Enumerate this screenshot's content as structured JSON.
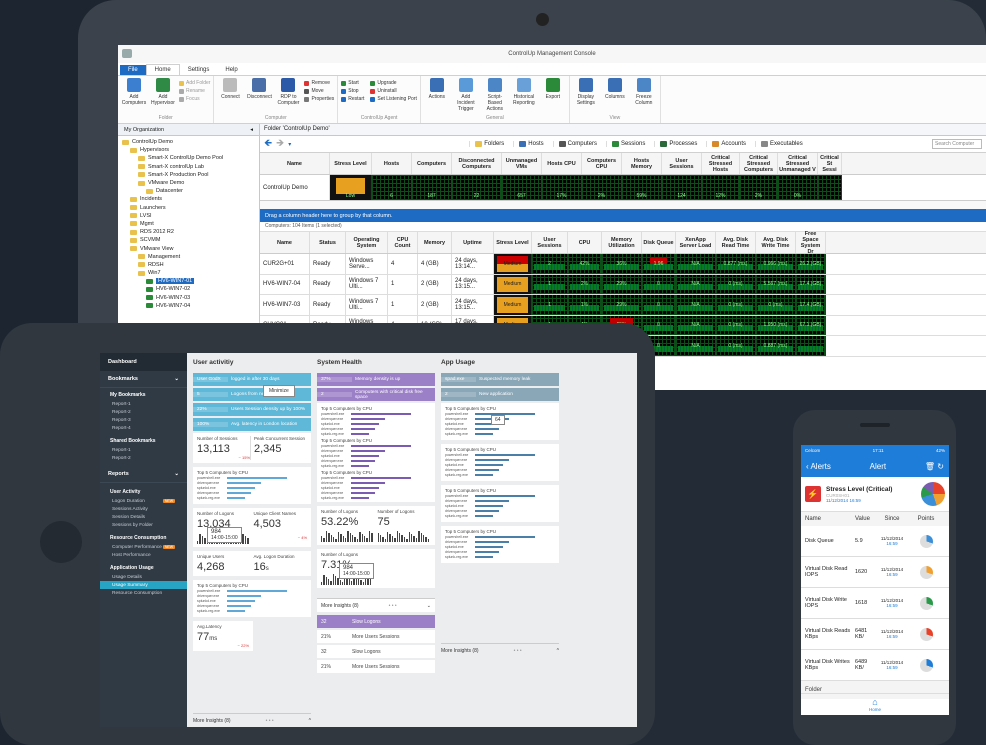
{
  "desktop": {
    "window_title": "ControlUp Management Console",
    "tabs": [
      "File",
      "Home",
      "Settings",
      "Help"
    ],
    "ribbon": {
      "folder_group": {
        "name": "Folder",
        "buttons": [
          "Add Computers",
          "Add Hypervisor"
        ],
        "small": [
          "Add Folder",
          "Rename",
          "Focus"
        ]
      },
      "computer_group": {
        "name": "Computer",
        "buttons": [
          "Connect",
          "Disconnect",
          "RDP to Computer",
          "Properties"
        ],
        "small": [
          "Remove",
          "Move",
          "Properties"
        ]
      },
      "agent_group": {
        "name": "ControlUp Agent",
        "small": [
          "Start",
          "Stop",
          "Restart",
          "Upgrade",
          "Uninstall",
          "Set Listening Port"
        ]
      },
      "general_group": {
        "name": "General",
        "buttons": [
          "Actions",
          "Add Incident Trigger",
          "Script-Based Actions",
          "Historical Reporting",
          "Export"
        ]
      },
      "view_group": {
        "name": "View",
        "buttons": [
          "Display Settings",
          "Columns",
          "Freeze Column"
        ]
      }
    },
    "org": {
      "header": "My Organization",
      "tree": [
        "ControlUp Demo",
        "Hypervisors",
        "Smart-X ControlUp Demo Pool",
        "Smart-X controlUp Lab",
        "Smart-X Production Pool",
        "VMware Demo",
        "Datacenter",
        "Incidents",
        "Launchers",
        "LVSI",
        "Mgmt",
        "RDS 2012 R2",
        "SCVMM",
        "VMware View",
        "Management",
        "RDSH",
        "Win7",
        "HV6-WIN7-01",
        "HV6-WIN7-02",
        "HV6-WIN7-03",
        "HV6-WIN7-04"
      ]
    },
    "folder_header": "Folder 'ControlUp Demo'",
    "views": [
      "Folders",
      "Hosts",
      "Computers",
      "Sessions",
      "Processes",
      "Accounts",
      "Executables"
    ],
    "search_placeholder": "Search Computer",
    "hosts_columns": [
      "Name",
      "Stress Level",
      "Hosts",
      "Computers",
      "Disconnected Computers",
      "Unmanaged VMs",
      "Hosts CPU",
      "Computers CPU",
      "Hosts Memory",
      "User Sessions",
      "Critical Stressed Hosts",
      "Critical Stressed Computers",
      "Critical Stressed Unmanaged V",
      "Critical St Sessi"
    ],
    "hosts_row": {
      "name": "ControlUp Demo",
      "values": [
        "Low",
        "6",
        "187",
        "22",
        "657",
        "17%",
        "2%",
        "59%",
        "124",
        "12%",
        "2%",
        "0%",
        ""
      ]
    },
    "drag_hint": "Drag a column header here to group by that column.",
    "count_text": "Computers: 104 Items (1 selected)",
    "comp_columns": [
      "Name",
      "Status",
      "Operating System",
      "CPU Count",
      "Memory",
      "Uptime",
      "Stress Level",
      "User Sessions",
      "CPU",
      "Memory Utilization",
      "Disk Queue",
      "XenApp Server Load",
      "Avg. Disk Read Time",
      "Avg. Disk Write Time",
      "Free Space System Dr"
    ],
    "computers": [
      {
        "name": "CUR2G+01",
        "status": "Ready",
        "os": "Windows Serve...",
        "cpu": "4",
        "mem": "4 (GB)",
        "up": "24 days, 13:14...",
        "stress": "Medium",
        "sess": "2",
        "cpuv": "42%",
        "memv": "36%",
        "dq": "1.96",
        "xen": "N/A",
        "dr": "0.877 (ms)",
        "dw": "0.966 (ms)",
        "fs": "26.2 (GB)"
      },
      {
        "name": "HV6-WIN7-04",
        "status": "Ready",
        "os": "Windows 7 Ulti...",
        "cpu": "1",
        "mem": "2 (GB)",
        "up": "24 days, 13:15...",
        "stress": "Medium",
        "sess": "1",
        "cpuv": "2%",
        "memv": "29%",
        "dq": "0",
        "xen": "N/A",
        "dr": "0 (ms)",
        "dw": "5.567 (ms)",
        "fs": "17.4 (GB)"
      },
      {
        "name": "HV6-WIN7-03",
        "status": "Ready",
        "os": "Windows 7 Ulti...",
        "cpu": "1",
        "mem": "2 (GB)",
        "up": "24 days, 13:15...",
        "stress": "Medium",
        "sess": "1",
        "cpuv": "1%",
        "memv": "29%",
        "dq": "0",
        "xen": "N/A",
        "dr": "0 (ms)",
        "dw": "0 (ms)",
        "fs": "17.4 (GB)"
      },
      {
        "name": "CUVC01",
        "status": "Ready",
        "os": "Windows Serve...",
        "cpu": "4",
        "mem": "10 (GB)",
        "up": "17 days, 21:49...",
        "stress": "Medium",
        "sess": "1",
        "cpuv": "4%",
        "memv": "65%",
        "dq": "0",
        "xen": "N/A",
        "dr": "0 (ms)",
        "dw": "1.950 (ms)",
        "fs": "67.1 (GB)"
      },
      {
        "name": "CUSQ0",
        "status": "Ready",
        "os": "Windows Serve...",
        "cpu": "2",
        "mem": "4 (GB)",
        "up": "24 days",
        "stress": "",
        "sess": "1",
        "cpuv": "3%",
        "memv": "",
        "dq": "0",
        "xen": "N/A",
        "dr": "0 (ms)",
        "dw": "0.887 (ms)",
        "fs": ""
      }
    ]
  },
  "tablet": {
    "sidebar": {
      "title": "Dashboard",
      "sections": [
        "Bookmarks",
        "Reports"
      ],
      "my_bookmarks": {
        "title": "My Bookmarks",
        "items": [
          "Report-1",
          "Report-2",
          "Report-3",
          "Report-4"
        ]
      },
      "shared_bookmarks": {
        "title": "Shared Bookmarks",
        "items": [
          "Report-1",
          "Report-2"
        ]
      },
      "user_activity": {
        "title": "User Activity",
        "items": [
          "Logon Duration",
          "Sessions Activity",
          "Session Details",
          "Sessions by Folder"
        ]
      },
      "resource": {
        "title": "Resource Consumption",
        "items": [
          "Computer Performance",
          "Host Performance"
        ]
      },
      "app_usage": {
        "title": "Application Usage",
        "items": [
          "Usage Details",
          "Usage Summary",
          "Resource Consumption"
        ]
      }
    },
    "user_activity": {
      "title": "User activitiy",
      "alerts": [
        {
          "value": "User GodX",
          "text": "logged in after 30 days"
        },
        {
          "value": "5",
          "text": "Logons from new computers"
        },
        {
          "value": "22%",
          "text": "Users Session density up by 100%"
        },
        {
          "value": "100%",
          "text": "Avg. latency in London location"
        }
      ],
      "minimize": "Minimize",
      "sessions": {
        "label": "Number of Sessions",
        "value": "13,113",
        "change": "~ 15%"
      },
      "peak": {
        "label": "Peak Concurrent Session",
        "value": "2,345"
      },
      "top5_title": "Top 5 Computers by CPU",
      "processes": [
        "powershell.exe",
        "driverquer.exe",
        "splunkd.exe",
        "driverquer.exe",
        "splunk-reg.exe"
      ],
      "logons": {
        "label": "Number of Logons",
        "value": "13,034",
        "tooltip_value": "984",
        "tooltip_time": "14:00-15:00"
      },
      "client_names": {
        "label": "Unique Client Names",
        "value": "4,503",
        "change": "~ 4%"
      },
      "unique_users": {
        "label": "Unique Users",
        "value": "4,268"
      },
      "logon_duration": {
        "label": "Avg. Logon Duration",
        "value": "16",
        "unit": "s"
      },
      "latency": {
        "label": "Avg.Latency",
        "value": "77",
        "unit": "ms",
        "change": "~ 22%"
      },
      "more": "More Insights (8)"
    },
    "system_health": {
      "title": "System Health",
      "alerts": [
        {
          "value": "37%",
          "text": "Memory density is up"
        },
        {
          "value": "2",
          "text": "Computers with critical disk free space"
        }
      ],
      "logons": {
        "label": "Number of Logons",
        "value": "53.22%",
        "change": "~ 3.1%"
      },
      "logons2": {
        "label": "Number of Logons",
        "value": "75"
      },
      "logons3": {
        "label": "Number of Logons",
        "value": "7.31%",
        "tooltip_value": "984",
        "tooltip_time": "14:00-15:00"
      },
      "more": "More Insights (8)",
      "insights": [
        {
          "value": "32",
          "text": "Slow Logons"
        },
        {
          "value": "21%",
          "text": "More Users Sessions"
        },
        {
          "value": "32",
          "text": "Slow Logons"
        },
        {
          "value": "21%",
          "text": "More Users Sessions"
        }
      ]
    },
    "app_usage": {
      "title": "App Usage",
      "alerts": [
        {
          "value": "spad.exe",
          "text": "Suspected memory leak"
        },
        {
          "value": "2",
          "text": "New application"
        }
      ],
      "tooltip_value": "64",
      "more": "More Insights (8)"
    }
  },
  "phone": {
    "carrier": "Celcom",
    "time": "17:11",
    "battery": "42%",
    "back_label": "Alerts",
    "title": "Alert",
    "alert_title": "Stress Level (Critical)",
    "alert_host": "CUR0SH01",
    "alert_date": "11/12/2014 16:59",
    "columns": [
      "Name",
      "Value",
      "Since",
      "Points"
    ],
    "rows": [
      {
        "name": "Disk Queue",
        "value": "5.9",
        "date": "11/12/2014",
        "time": "16:59"
      },
      {
        "name": "Virtual Disk Read IOPS",
        "value": "1620",
        "date": "11/12/2014",
        "time": "16:59"
      },
      {
        "name": "Virtual Disk Write IOPS",
        "value": "1618",
        "date": "11/12/2014",
        "time": "16:59"
      },
      {
        "name": "Virtual Disk Reads KBps",
        "value": "6481 KB/",
        "date": "11/12/2014",
        "time": "16:59"
      },
      {
        "name": "Virtual Disk Writes KBps",
        "value": "6489 KB/",
        "date": "11/12/2014",
        "time": "16:59"
      }
    ],
    "folder_label": "Folder",
    "tab_home": "Home"
  },
  "colors": {
    "accent": "#1e6bc4",
    "teal": "#27a3c4",
    "purple": "#9b7fc7",
    "steel": "#8aa7b8",
    "grid_green": "#0a7a20",
    "stress_medium": "#e8a020",
    "stress_high": "#c00000"
  }
}
